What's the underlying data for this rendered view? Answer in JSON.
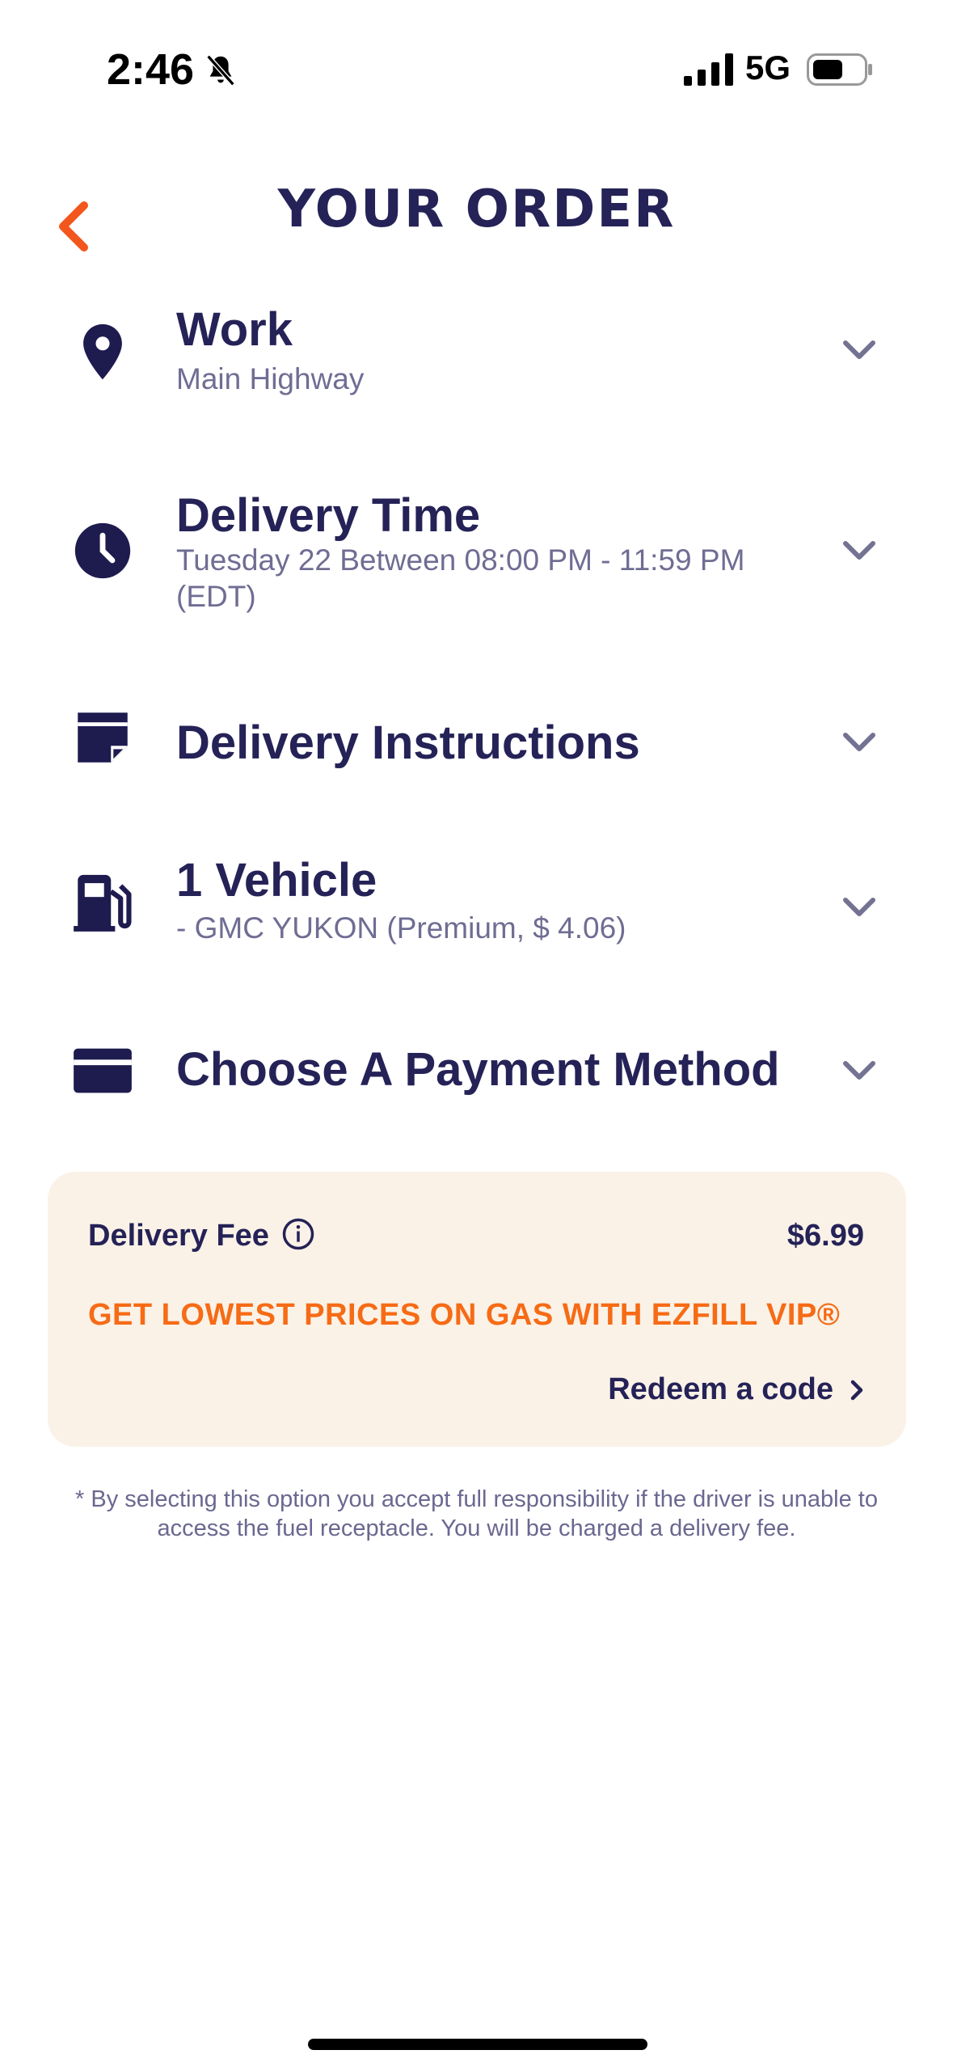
{
  "status_bar": {
    "time": "2:46",
    "network": "5G"
  },
  "header": {
    "title": "YOUR ORDER"
  },
  "rows": [
    {
      "title": "Work",
      "subtitle": "Main Highway"
    },
    {
      "title": "Delivery Time",
      "subtitle": "Tuesday 22 Between 08:00 PM - 11:59 PM (EDT)"
    },
    {
      "title": "Delivery Instructions"
    },
    {
      "title": "1 Vehicle",
      "subtitle": "- GMC YUKON (Premium, $ 4.06)"
    },
    {
      "title": "Choose A Payment Method"
    }
  ],
  "fee_card": {
    "label": "Delivery Fee",
    "value": "$6.99",
    "promo": "GET LOWEST PRICES ON GAS WITH EZFILL VIP®",
    "redeem": "Redeem a code"
  },
  "disclaimer": "* By selecting this option you accept full responsibility if the driver is unable to access the fuel receptacle. You will be charged a delivery fee.",
  "colors": {
    "primary": "#252257",
    "accent": "#f66b16",
    "card_bg": "#faf2e7",
    "muted": "#6f6d93"
  },
  "icons": [
    "bell-slash-icon",
    "signal-icon",
    "battery-icon",
    "back-icon",
    "location-pin-icon",
    "clock-icon",
    "note-icon",
    "fuel-pump-icon",
    "credit-card-icon",
    "chevron-down-icon",
    "info-icon",
    "chevron-right-icon"
  ]
}
